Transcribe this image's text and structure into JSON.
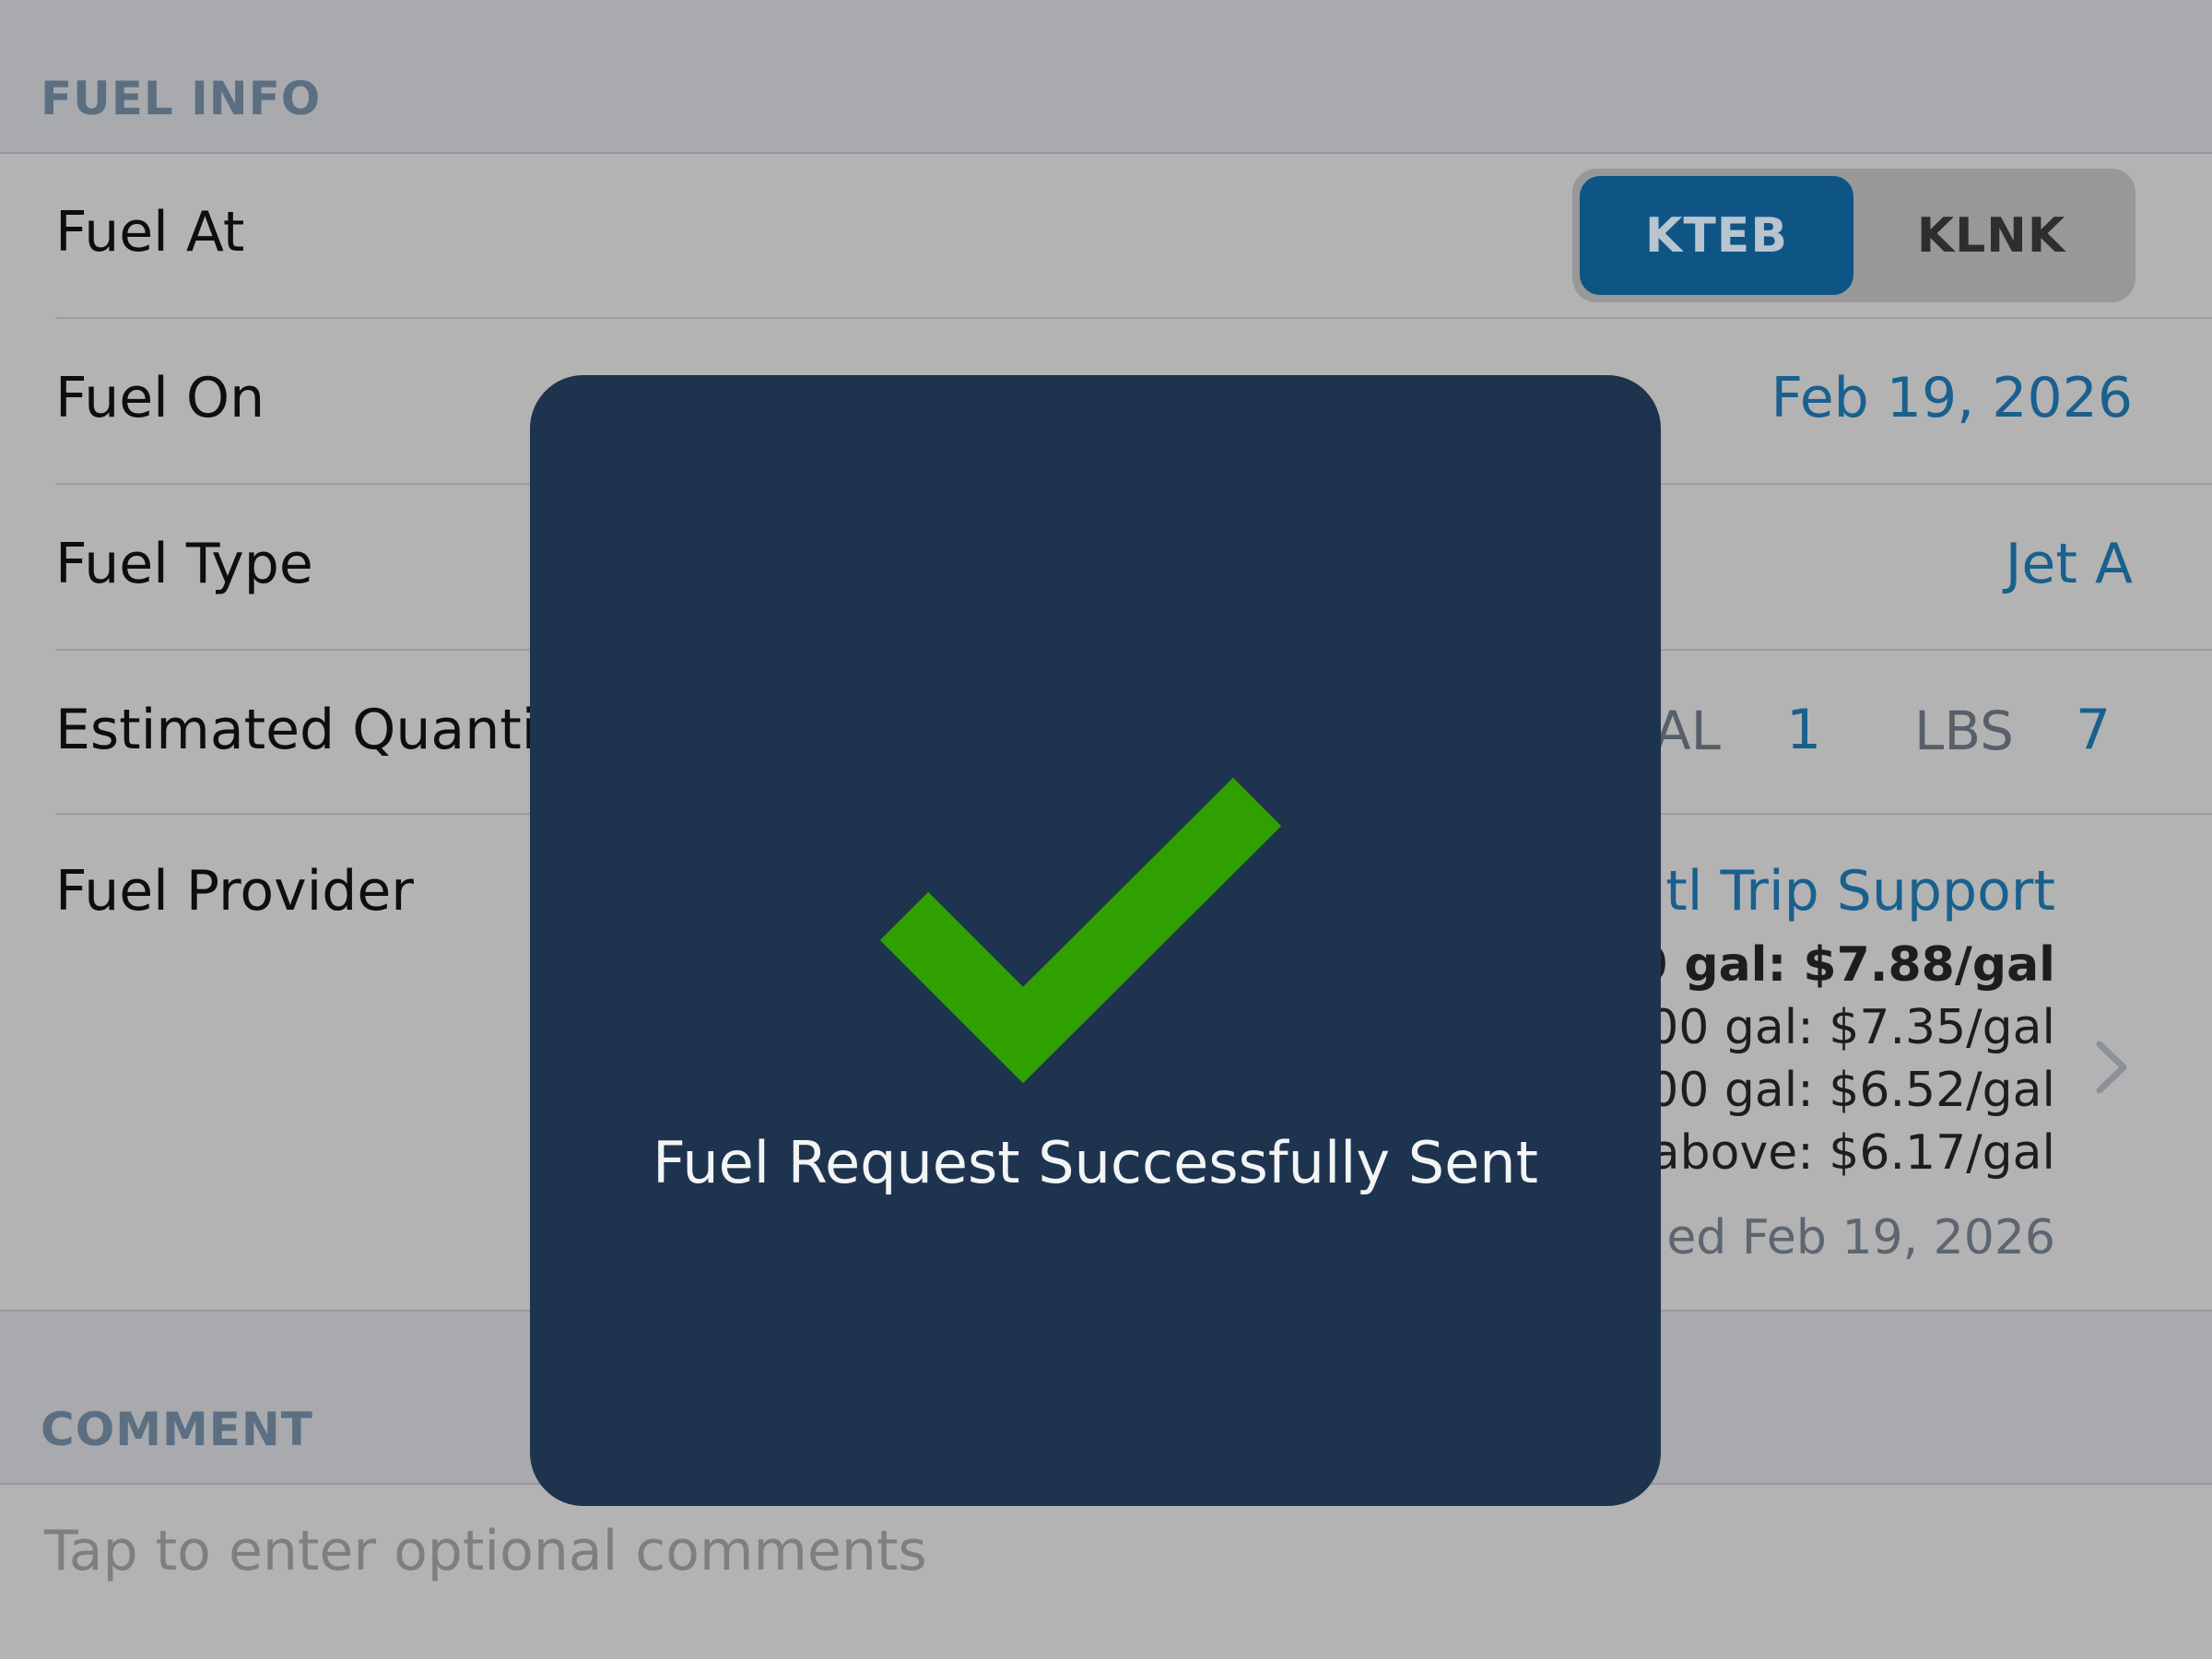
{
  "fuel_info": {
    "header": "FUEL INFO",
    "fuel_at": {
      "label": "Fuel At",
      "options": [
        "KTEB",
        "KLNK"
      ],
      "selected": "KTEB"
    },
    "fuel_on": {
      "label": "Fuel On",
      "value": "Feb 19, 2026"
    },
    "fuel_type": {
      "label": "Fuel Type",
      "value": "Jet A"
    },
    "estimated_quantity": {
      "label": "Estimated Quanti",
      "gal_unit": "AL",
      "gal_value": "1",
      "lbs_unit": "LBS",
      "lbs_value": "7"
    },
    "fuel_provider": {
      "label": "Fuel Provider",
      "name": "tl Trip Support",
      "price_tiers": [
        "0 gal: $7.88/gal",
        "00 gal: $7.35/gal",
        "00 gal: $6.52/gal",
        "above: $6.17/gal"
      ],
      "updated": "ed Feb 19, 2026"
    }
  },
  "comment": {
    "header": "COMMENT",
    "placeholder": "Tap to enter optional comments"
  },
  "hud": {
    "icon": "checkmark-icon",
    "message": "Fuel Request Successfully Sent",
    "check_color": "#2fa000",
    "background": "#1e344e"
  }
}
